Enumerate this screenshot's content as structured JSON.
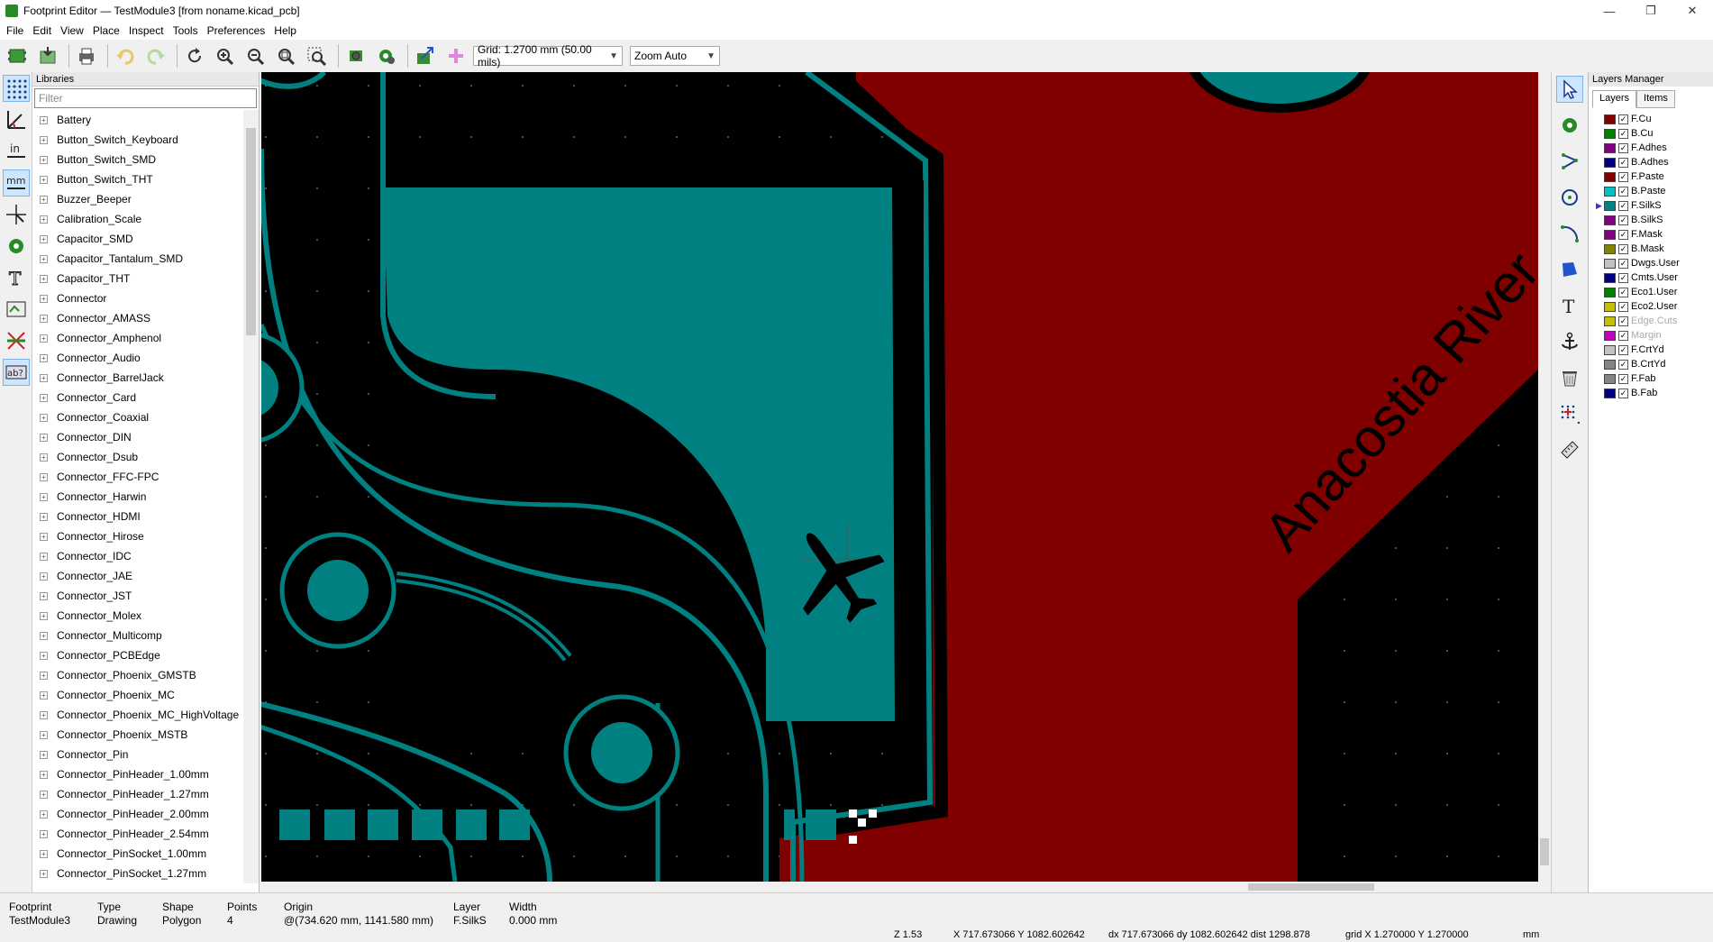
{
  "window": {
    "title": "Footprint Editor — TestModule3 [from noname.kicad_pcb]",
    "controls": [
      "—",
      "❐",
      "✕"
    ]
  },
  "menu": [
    "File",
    "Edit",
    "View",
    "Place",
    "Inspect",
    "Tools",
    "Preferences",
    "Help"
  ],
  "toolbar": {
    "grid": "Grid: 1.2700 mm (50.00 mils)",
    "zoom": "Zoom Auto"
  },
  "libraries": {
    "header": "Libraries",
    "filter_placeholder": "Filter",
    "items": [
      "Battery",
      "Button_Switch_Keyboard",
      "Button_Switch_SMD",
      "Button_Switch_THT",
      "Buzzer_Beeper",
      "Calibration_Scale",
      "Capacitor_SMD",
      "Capacitor_Tantalum_SMD",
      "Capacitor_THT",
      "Connector",
      "Connector_AMASS",
      "Connector_Amphenol",
      "Connector_Audio",
      "Connector_BarrelJack",
      "Connector_Card",
      "Connector_Coaxial",
      "Connector_DIN",
      "Connector_Dsub",
      "Connector_FFC-FPC",
      "Connector_Harwin",
      "Connector_HDMI",
      "Connector_Hirose",
      "Connector_IDC",
      "Connector_JAE",
      "Connector_JST",
      "Connector_Molex",
      "Connector_Multicomp",
      "Connector_PCBEdge",
      "Connector_Phoenix_GMSTB",
      "Connector_Phoenix_MC",
      "Connector_Phoenix_MC_HighVoltage",
      "Connector_Phoenix_MSTB",
      "Connector_Pin",
      "Connector_PinHeader_1.00mm",
      "Connector_PinHeader_1.27mm",
      "Connector_PinHeader_2.00mm",
      "Connector_PinHeader_2.54mm",
      "Connector_PinSocket_1.00mm",
      "Connector_PinSocket_1.27mm"
    ]
  },
  "canvas": {
    "label_text": "Anacostia River",
    "colors": {
      "background": "#000000",
      "copper_teal": "#008080",
      "river_red": "#800000"
    }
  },
  "layers_manager": {
    "header": "Layers Manager",
    "tabs": [
      "Layers",
      "Items"
    ],
    "layers": [
      {
        "name": "F.Cu",
        "color": "#840000",
        "enabled": true
      },
      {
        "name": "B.Cu",
        "color": "#008400",
        "enabled": true
      },
      {
        "name": "F.Adhes",
        "color": "#840084",
        "enabled": true
      },
      {
        "name": "B.Adhes",
        "color": "#000084",
        "enabled": true
      },
      {
        "name": "F.Paste",
        "color": "#840000",
        "enabled": true
      },
      {
        "name": "B.Paste",
        "color": "#00c2c2",
        "enabled": true
      },
      {
        "name": "F.SilkS",
        "color": "#008484",
        "enabled": true
      },
      {
        "name": "B.SilkS",
        "color": "#840084",
        "enabled": true
      },
      {
        "name": "F.Mask",
        "color": "#840084",
        "enabled": true
      },
      {
        "name": "B.Mask",
        "color": "#848400",
        "enabled": true
      },
      {
        "name": "Dwgs.User",
        "color": "#c2c2c2",
        "enabled": true
      },
      {
        "name": "Cmts.User",
        "color": "#000084",
        "enabled": true
      },
      {
        "name": "Eco1.User",
        "color": "#008400",
        "enabled": true
      },
      {
        "name": "Eco2.User",
        "color": "#c2c200",
        "enabled": true
      },
      {
        "name": "Edge.Cuts",
        "color": "#c2c200",
        "enabled": true,
        "dim": true
      },
      {
        "name": "Margin",
        "color": "#c200c2",
        "enabled": true,
        "dim": true
      },
      {
        "name": "F.CrtYd",
        "color": "#c2c2c2",
        "enabled": true
      },
      {
        "name": "B.CrtYd",
        "color": "#848484",
        "enabled": true
      },
      {
        "name": "F.Fab",
        "color": "#848484",
        "enabled": true
      },
      {
        "name": "B.Fab",
        "color": "#000084",
        "enabled": true
      }
    ]
  },
  "status": {
    "footprint_label": "Footprint",
    "footprint_value": "TestModule3",
    "type_label": "Type",
    "type_value": "Drawing",
    "shape_label": "Shape",
    "shape_value": "Polygon",
    "points_label": "Points",
    "points_value": "4",
    "origin_label": "Origin",
    "origin_value": "@(734.620 mm, 1141.580 mm)",
    "layer_label": "Layer",
    "layer_value": "F.SilkS",
    "width_label": "Width",
    "width_value": "0.000 mm",
    "zoom": "Z 1.53",
    "xy": "X 717.673066  Y 1082.602642",
    "dxdy": "dx 717.673066  dy 1082.602642  dist 1298.878",
    "grid": "grid X 1.270000  Y 1.270000",
    "units": "mm"
  }
}
